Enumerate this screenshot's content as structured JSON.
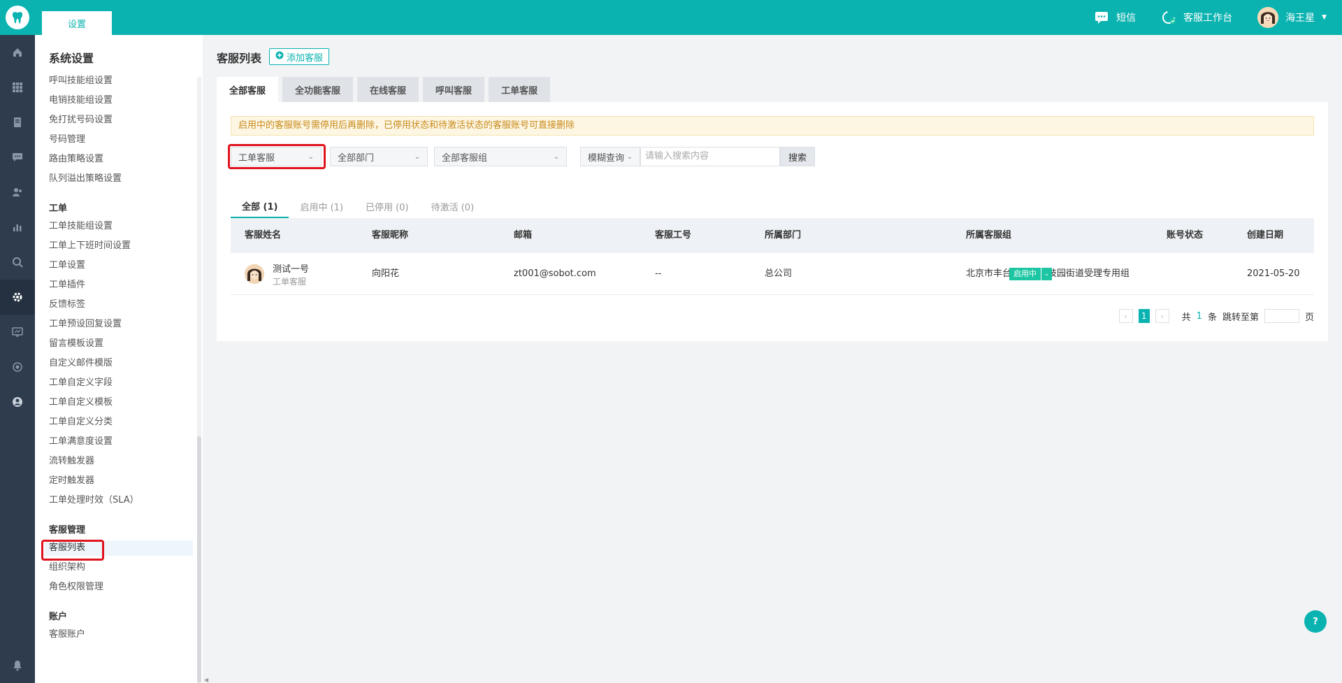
{
  "topbar": {
    "tab_label": "设置",
    "sms_label": "短信",
    "workbench_label": "客服工作台",
    "user_name": "海王星"
  },
  "rail": {
    "icons": [
      "home-icon",
      "apps-icon",
      "document-icon",
      "chat-icon",
      "users-icon",
      "chart-icon",
      "search-icon",
      "settings-icon",
      "monitor-icon",
      "camera-icon",
      "profile-icon"
    ],
    "bell_icon": "bell-icon"
  },
  "sidebar": {
    "title": "系统设置",
    "groups": {
      "call": {
        "items": [
          "呼叫技能组设置",
          "电销技能组设置",
          "免打扰号码设置",
          "号码管理",
          "路由策略设置",
          "队列溢出策略设置"
        ]
      },
      "ticket": {
        "title": "工单",
        "items": [
          "工单技能组设置",
          "工单上下班时间设置",
          "工单设置",
          "工单插件",
          "反馈标签",
          "工单预设回复设置",
          "留言模板设置",
          "自定义邮件模版",
          "工单自定义字段",
          "工单自定义模板",
          "工单自定义分类",
          "工单满意度设置",
          "流转触发器",
          "定时触发器",
          "工单处理时效（SLA）"
        ]
      },
      "agent": {
        "title": "客服管理",
        "items": [
          "客服列表",
          "组织架构",
          "角色权限管理"
        ]
      },
      "account": {
        "title": "账户",
        "items": [
          "客服账户"
        ]
      }
    }
  },
  "main": {
    "title": "客服列表",
    "add_button": "添加客服",
    "tabs": [
      "全部客服",
      "全功能客服",
      "在线客服",
      "呼叫客服",
      "工单客服"
    ],
    "notice": "启用中的客服账号需停用后再删除，已停用状态和待激活状态的客服账号可直接删除",
    "filters": {
      "type": "工单客服",
      "department": "全部部门",
      "group": "全部客服组",
      "query_mode": "模糊查询",
      "search_placeholder": "请输入搜索内容",
      "search_button": "搜索"
    },
    "subtabs": [
      "全部 (1)",
      "启用中 (1)",
      "已停用 (0)",
      "待激活 (0)"
    ],
    "table": {
      "headers": [
        "客服姓名",
        "客服昵称",
        "邮箱",
        "客服工号",
        "所属部门",
        "所属客服组",
        "账号状态",
        "创建日期"
      ],
      "rows": [
        {
          "name": "测试一号",
          "role": "工单客服",
          "nickname": "向阳花",
          "email": "zt001@sobot.com",
          "employee_id": "--",
          "department": "总公司",
          "group": "北京市丰台区丰台科技园街道受理专用组",
          "status": "启用中",
          "created": "2021-05-20"
        }
      ]
    },
    "pager": {
      "current": "1",
      "total_prefix": "共",
      "total_count": "1",
      "total_suffix": "条",
      "jump_label": "跳转至第",
      "page_suffix": "页"
    }
  },
  "help_label": "?",
  "colors": {
    "brand": "#0ab3b0",
    "highlight": "#e0141e",
    "status_active": "#1cc6a2"
  }
}
